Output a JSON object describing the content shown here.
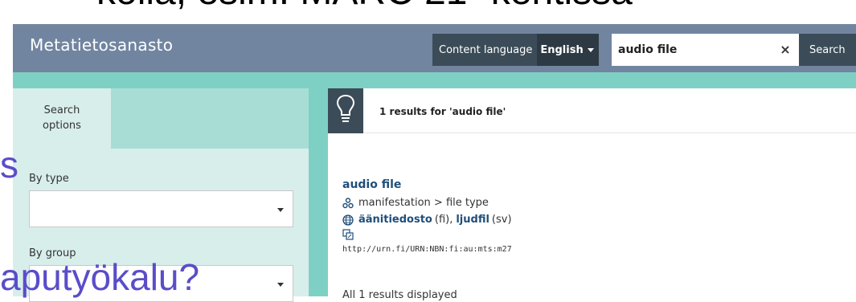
{
  "slide": {
    "top_text": "kolla, esim. MARC 21 -kentissä",
    "left_text": "s",
    "bottom_text": "aputyökalu?"
  },
  "header": {
    "brand": "Metatietosanasto",
    "content_language_label": "Content language",
    "content_language_value": "English",
    "search_value": "audio file",
    "clear_symbol": "×",
    "search_label": "Search"
  },
  "sidebar": {
    "tab_label": "Search options",
    "filters": [
      {
        "label": "By type",
        "value": ""
      },
      {
        "label": "By group",
        "value": ""
      }
    ]
  },
  "results": {
    "count_text": "1 results for 'audio file'",
    "items": [
      {
        "term": "audio file",
        "hierarchy": "manifestation > file type",
        "alt_fi": "äänitiedosto",
        "alt_fi_lang": "(fi),",
        "alt_sv": "ljudfil",
        "alt_sv_lang": "(sv)",
        "uri": "http://urn.fi/URN:NBN:fi:au:mts:m27"
      }
    ],
    "footer": "All 1 results displayed"
  },
  "icons": [
    "lightbulb-icon",
    "hierarchy-icon",
    "globe-icon",
    "translate-icon",
    "chevron-down-icon"
  ]
}
